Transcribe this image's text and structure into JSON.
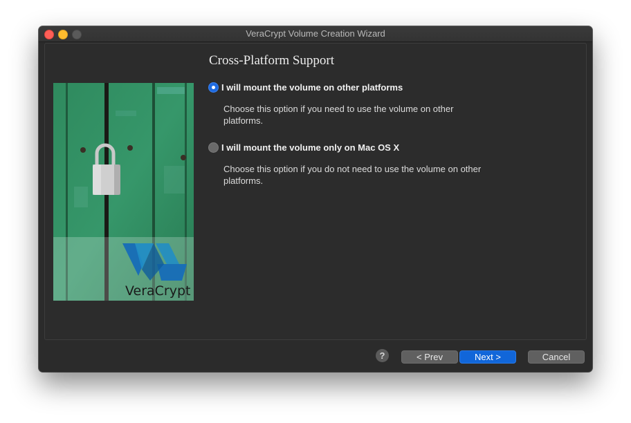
{
  "window": {
    "title": "VeraCrypt Volume Creation Wizard"
  },
  "page": {
    "title": "Cross-Platform Support"
  },
  "options": [
    {
      "label": "I will mount the volume on other platforms",
      "description": "Choose this option if you need to use the volume on other platforms.",
      "selected": true
    },
    {
      "label": "I will mount the volume only on Mac OS X",
      "description": "Choose this option if you do not need to use the volume on other platforms.",
      "selected": false
    }
  ],
  "banner": {
    "brand_text": "VeraCrypt"
  },
  "buttons": {
    "help": "?",
    "prev": "< Prev",
    "next": "Next >",
    "cancel": "Cancel"
  },
  "colors": {
    "accent": "#1166d9",
    "window_bg": "#2b2b2b",
    "banner_green": "#2f8a5e",
    "logo_blue": "#1a6fb5"
  }
}
